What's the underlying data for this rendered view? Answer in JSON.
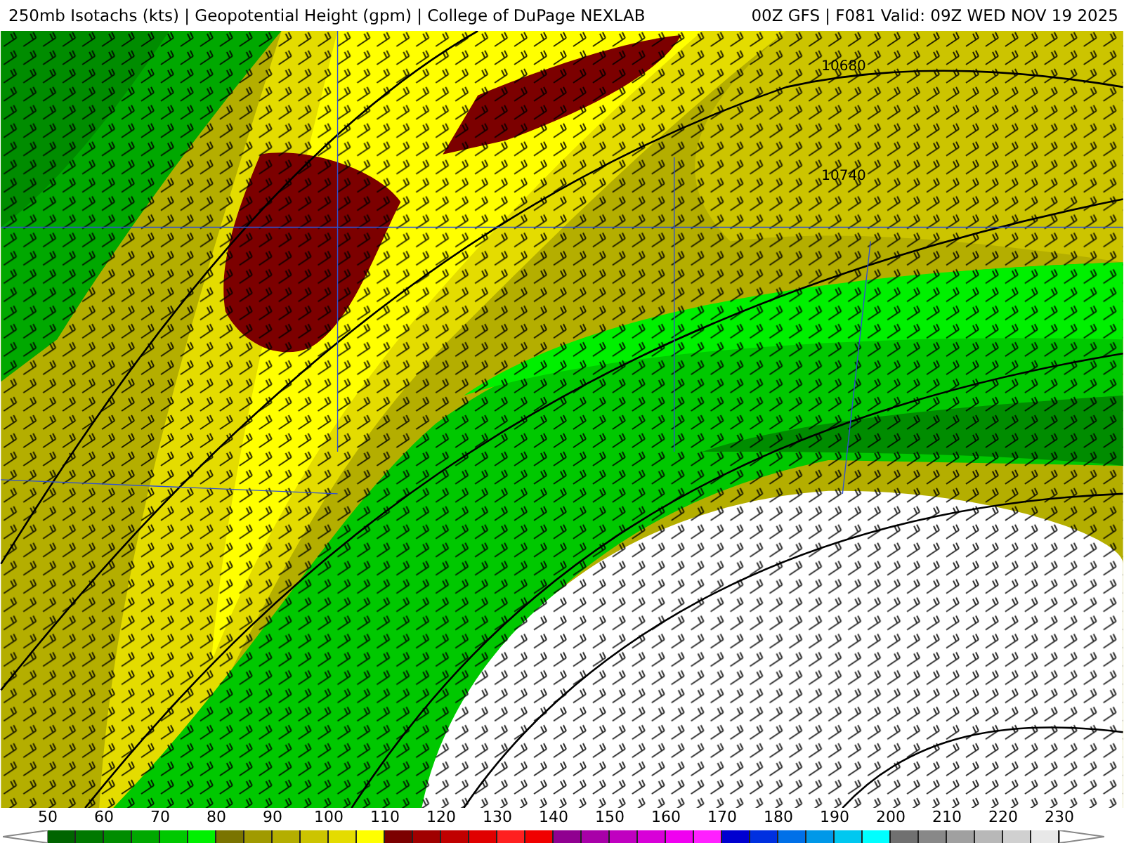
{
  "header": {
    "title": "250mb Isotachs (kts) | Geopotential Height (gpm) | College of DuPage NEXLAB",
    "run": "00Z GFS | F081 Valid: 09Z WED NOV 19 2025"
  },
  "map": {
    "contour_labels": [
      "10680",
      "10740"
    ]
  },
  "legend": {
    "labels": [
      "50",
      "60",
      "70",
      "80",
      "90",
      "100",
      "110",
      "120",
      "130",
      "140",
      "150",
      "160",
      "170",
      "180",
      "190",
      "200",
      "210",
      "220",
      "230"
    ],
    "swatches": [
      {
        "color": "#006400"
      },
      {
        "color": "#007800"
      },
      {
        "color": "#008c00"
      },
      {
        "color": "#00a800"
      },
      {
        "color": "#00c800"
      },
      {
        "color": "#00f000"
      },
      {
        "color": "#7a7400"
      },
      {
        "color": "#a09a00"
      },
      {
        "color": "#b4ae00"
      },
      {
        "color": "#ccc400"
      },
      {
        "color": "#e4dc00"
      },
      {
        "color": "#ffff00"
      },
      {
        "color": "#7c0000"
      },
      {
        "color": "#a00000"
      },
      {
        "color": "#c00000"
      },
      {
        "color": "#e00000"
      },
      {
        "color": "#ff2020"
      },
      {
        "color": "#f00000"
      },
      {
        "color": "#900090"
      },
      {
        "color": "#a800a8"
      },
      {
        "color": "#c000c0"
      },
      {
        "color": "#d800d8"
      },
      {
        "color": "#f000f0"
      },
      {
        "color": "#ff20ff"
      },
      {
        "color": "#0000d0"
      },
      {
        "color": "#0030e0"
      },
      {
        "color": "#0070e8"
      },
      {
        "color": "#0098e8"
      },
      {
        "color": "#00c8f0"
      },
      {
        "color": "#00ffff"
      },
      {
        "color": "#707070"
      },
      {
        "color": "#888888"
      },
      {
        "color": "#a0a0a0"
      },
      {
        "color": "#b8b8b8"
      },
      {
        "color": "#d0d0d0"
      },
      {
        "color": "#e8e8e8"
      }
    ]
  }
}
